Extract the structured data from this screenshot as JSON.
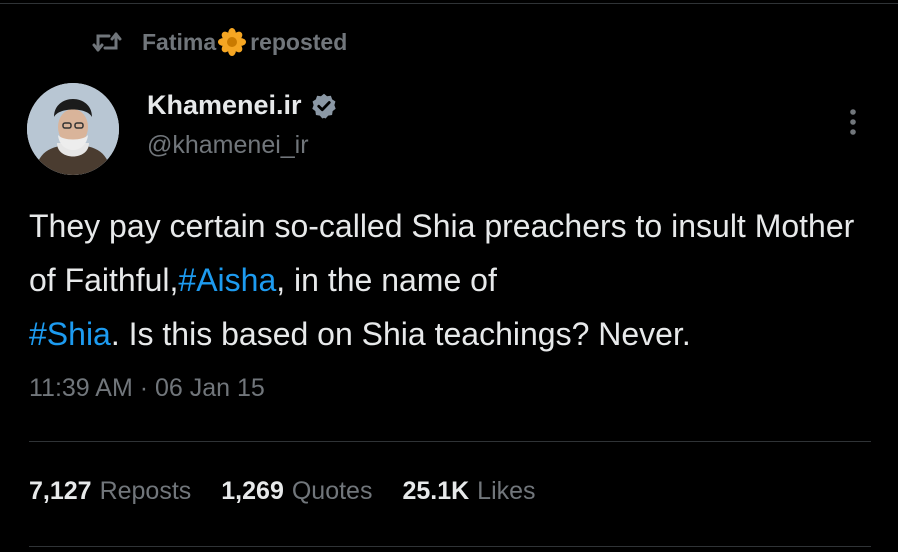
{
  "repost": {
    "user": "Fatima",
    "action": "reposted",
    "icon": "repost-icon",
    "emoji_icon": "flower-icon"
  },
  "author": {
    "name": "Khamenei.ir",
    "handle": "@khamenei_ir",
    "verified": true,
    "verified_color": "#1d9bf0"
  },
  "tweet": {
    "segments": [
      {
        "text": "They pay certain so-called Shia preachers to insult Mother of Faithful,",
        "hashtag": false
      },
      {
        "text": "#Aisha",
        "hashtag": true
      },
      {
        "text": ", in the name of ",
        "hashtag": false
      },
      {
        "text": "#Shia",
        "hashtag": true
      },
      {
        "text": ". Is this based on Shia teachings? Never.",
        "hashtag": false
      }
    ]
  },
  "meta": {
    "time": "11:39 AM",
    "separator": "·",
    "date": "06 Jan 15"
  },
  "stats": {
    "reposts": {
      "count": "7,127",
      "label": "Reposts"
    },
    "quotes": {
      "count": "1,269",
      "label": "Quotes"
    },
    "likes": {
      "count": "25.1K",
      "label": "Likes"
    }
  },
  "colors": {
    "background": "#000000",
    "text": "#e7e9ea",
    "muted": "#71767b",
    "accent": "#1d9bf0",
    "border": "#2f3336"
  }
}
